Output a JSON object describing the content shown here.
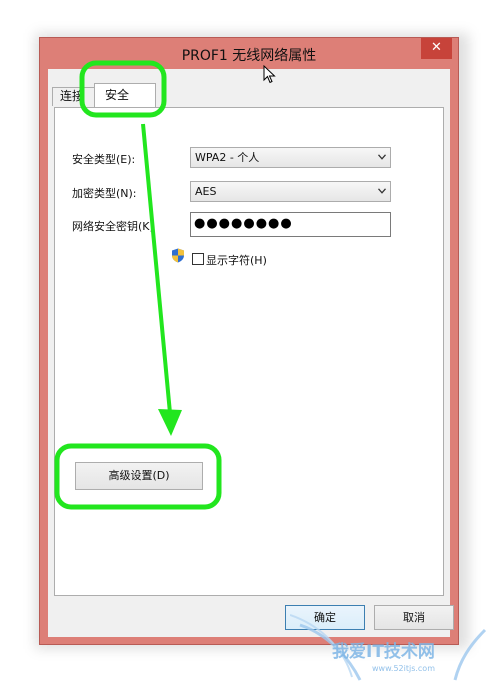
{
  "window": {
    "title": "PROF1 无线网络属性",
    "close_glyph": "✕",
    "title_color": "#dd7f77"
  },
  "tabs": [
    {
      "label": "连接",
      "active": false
    },
    {
      "label": "安全",
      "active": true
    }
  ],
  "security": {
    "type_label": "安全类型(E):",
    "type_value": "WPA2 - 个人",
    "encryption_label": "加密类型(N):",
    "encryption_value": "AES",
    "key_label": "网络安全密钥(K)",
    "key_value": "●●●●●●●●",
    "show_chars_label": "显示字符(H)",
    "show_chars_checked": false
  },
  "advanced_button": "高级设置(D)",
  "footer": {
    "ok": "确定",
    "cancel": "取消"
  },
  "annotation": {
    "highlight_color": "#22e61e",
    "arrow_color": "#22e61e"
  },
  "watermark": {
    "text": "我爱IT技术网",
    "url": "www.52itjs.com",
    "color": "#7fb6e6"
  },
  "icons": {
    "shield": "uac-shield-icon",
    "cursor": "mouse-pointer-icon"
  }
}
